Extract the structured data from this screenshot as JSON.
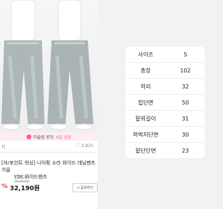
{
  "product": {
    "coupon_text": "더슬림 로모",
    "coupon_date": "4일 남음",
    "shop": "키",
    "likes": "2,825",
    "title_line1": "[자/포인트 워싱] 니아핑 소라 와이드 데님팬츠 가을",
    "title_line2": "Y2K 와이드팬츠",
    "meta": "면직원포",
    "original_price": "45,000원",
    "discount": "%",
    "price": "32,190원",
    "share_label": "공유하기"
  },
  "size_table": {
    "header": [
      "사이즈",
      "S"
    ],
    "rows": [
      [
        "총장",
        "102"
      ],
      [
        "허리",
        "32"
      ],
      [
        "힙단면",
        "50"
      ],
      [
        "밑위길이",
        "31"
      ],
      [
        "허벅지단면",
        "30"
      ],
      [
        "밑단단면",
        "23"
      ]
    ]
  },
  "colors": {
    "accent": "#ff5b86",
    "discount": "#ff3b3b",
    "denim": "#aeb7b8"
  }
}
